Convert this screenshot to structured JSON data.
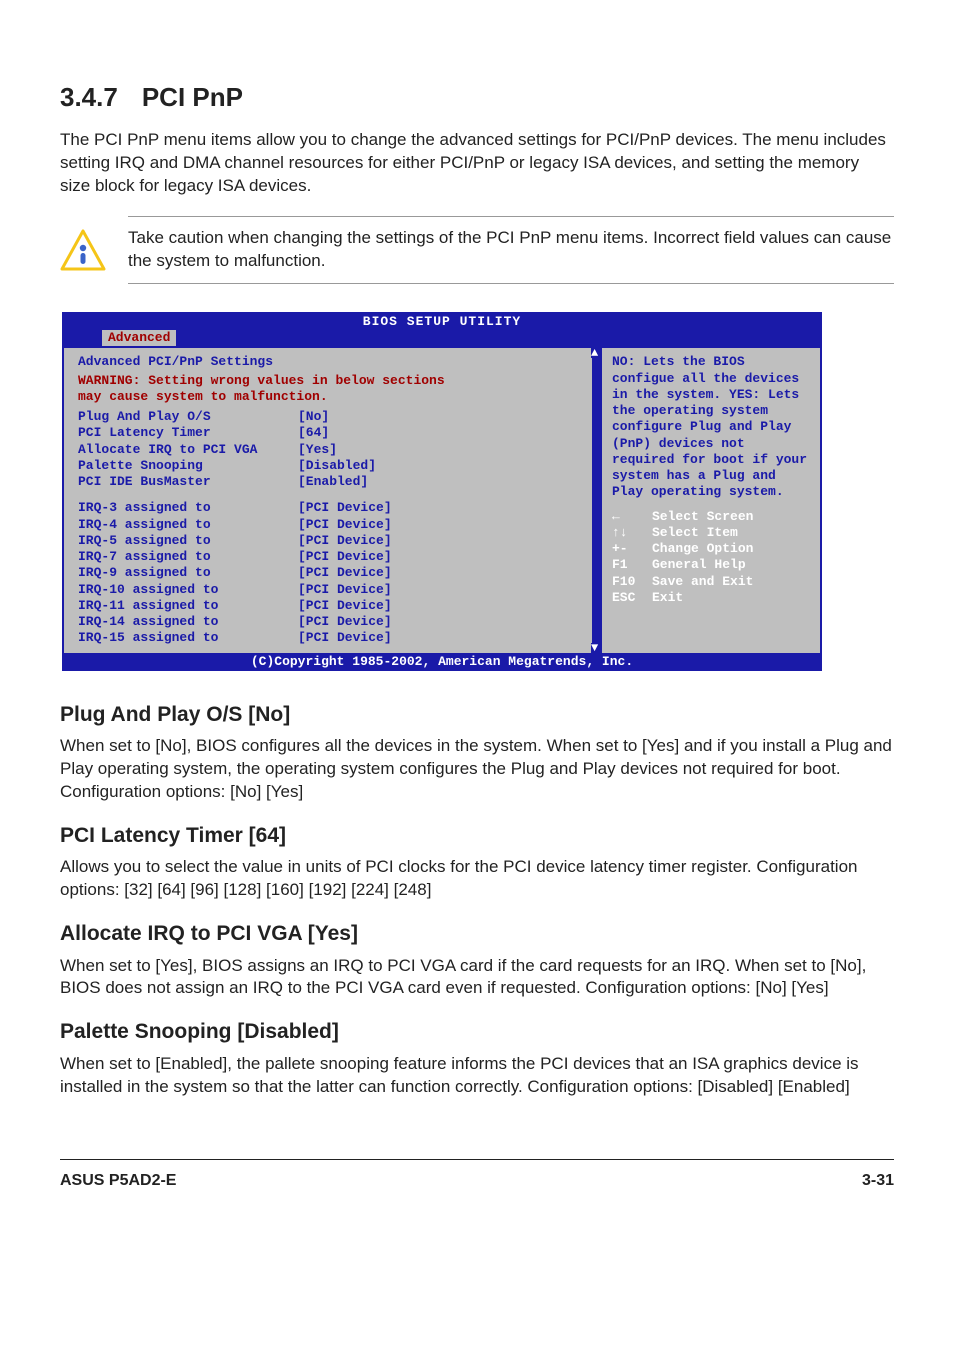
{
  "section": {
    "number": "3.4.7",
    "title": "PCI PnP"
  },
  "intro": "The PCI PnP menu items allow you to change the advanced settings for PCI/PnP devices. The menu includes setting IRQ and DMA channel resources for either PCI/PnP or legacy ISA devices, and setting the memory size block for legacy ISA devices.",
  "caution": "Take caution when changing the settings of the PCI PnP menu items. Incorrect field values can cause the system to malfunction.",
  "bios": {
    "title": "BIOS SETUP UTILITY",
    "tab": "Advanced",
    "panel_heading": "Advanced PCI/PnP Settings",
    "warning_l1": "WARNING: Setting wrong values in below sections",
    "warning_l2": "         may cause system to malfunction.",
    "settings": [
      {
        "label": "Plug And Play O/S",
        "value": "[No]"
      },
      {
        "label": "PCI Latency Timer",
        "value": "[64]"
      },
      {
        "label": "Allocate IRQ to PCI VGA",
        "value": "[Yes]"
      },
      {
        "label": "Palette Snooping",
        "value": "[Disabled]"
      },
      {
        "label": "PCI IDE BusMaster",
        "value": "[Enabled]"
      }
    ],
    "irq": [
      {
        "label": "IRQ-3 assigned to",
        "value": "[PCI Device]"
      },
      {
        "label": "IRQ-4 assigned to",
        "value": "[PCI Device]"
      },
      {
        "label": "IRQ-5 assigned to",
        "value": "[PCI Device]"
      },
      {
        "label": "IRQ-7 assigned to",
        "value": "[PCI Device]"
      },
      {
        "label": "IRQ-9 assigned to",
        "value": "[PCI Device]"
      },
      {
        "label": "IRQ-10 assigned to",
        "value": "[PCI Device]"
      },
      {
        "label": "IRQ-11 assigned to",
        "value": "[PCI Device]"
      },
      {
        "label": "IRQ-14 assigned to",
        "value": "[PCI Device]"
      },
      {
        "label": "IRQ-15 assigned to",
        "value": "[PCI Device]"
      }
    ],
    "help_desc": "NO: Lets the BIOS configue all the devices in the system. YES: Lets the operating system configure Plug and Play (PnP) devices not required for boot if your system has a Plug and Play operating system.",
    "nav": [
      {
        "key": "←",
        "label": "Select Screen"
      },
      {
        "key": "↑↓",
        "label": "Select Item"
      },
      {
        "key": "+-",
        "label": "Change Option"
      },
      {
        "key": "F1",
        "label": "General Help"
      },
      {
        "key": "F10",
        "label": "Save and Exit"
      },
      {
        "key": "ESC",
        "label": "Exit"
      }
    ],
    "footer": "(C)Copyright 1985-2002, American Megatrends, Inc."
  },
  "subs": {
    "plug_title": "Plug And Play O/S [No]",
    "plug_body": "When set to [No], BIOS configures all the devices in the system. When set to [Yes] and if you install a Plug and Play operating system, the operating system configures the Plug and Play devices not required for boot. Configuration options: [No] [Yes]",
    "lat_title": "PCI Latency Timer [64]",
    "lat_body": "Allows you to select the value in units of PCI clocks for the PCI device latency timer register. Configuration options: [32] [64] [96] [128] [160] [192] [224] [248]",
    "irq_title": "Allocate IRQ to PCI VGA [Yes]",
    "irq_body": "When set to [Yes], BIOS assigns an IRQ to PCI VGA card if the card requests for an IRQ. When set to [No], BIOS does not assign an IRQ to the PCI VGA card even if requested. Configuration options: [No] [Yes]",
    "pal_title": "Palette Snooping [Disabled]",
    "pal_body": "When set to [Enabled], the pallete snooping feature informs the PCI devices that an ISA graphics device is installed in the system so that the latter can function correctly. Configuration options: [Disabled] [Enabled]"
  },
  "footer": {
    "left": "ASUS P5AD2-E",
    "right": "3-31"
  }
}
